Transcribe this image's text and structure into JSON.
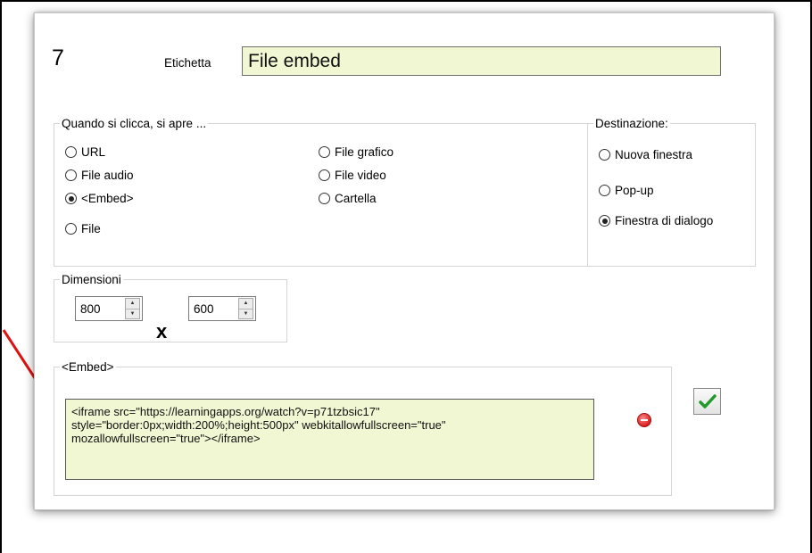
{
  "header": {
    "number": "7",
    "label_text": "Etichetta",
    "label_value": "File embed"
  },
  "open_group": {
    "legend": "Quando si clicca, si apre ...",
    "options": [
      {
        "label": "URL",
        "selected": false
      },
      {
        "label": "File audio",
        "selected": false
      },
      {
        "label": "<Embed>",
        "selected": true
      },
      {
        "label": "File",
        "selected": false
      },
      {
        "label": "File grafico",
        "selected": false
      },
      {
        "label": "File video",
        "selected": false
      },
      {
        "label": "Cartella",
        "selected": false
      }
    ]
  },
  "destination_group": {
    "legend": "Destinazione:",
    "options": [
      {
        "label": "Nuova finestra",
        "selected": false
      },
      {
        "label": "Pop-up",
        "selected": false
      },
      {
        "label": "Finestra di dialogo",
        "selected": true
      }
    ]
  },
  "dimensions_group": {
    "legend": "Dimensioni",
    "width": "800",
    "height": "600",
    "separator": "x"
  },
  "embed_group": {
    "legend": "<Embed>",
    "code": "<iframe src=\"https://learningapps.org/watch?v=p71tzbsic17\"\nstyle=\"border:0px;width:200%;height:500px\" webkitallowfullscreen=\"true\"\nmozallowfullscreen=\"true\"></iframe>"
  },
  "icons": {
    "remove": "minus-circle-icon",
    "confirm": "checkmark-icon",
    "annotation": "red-arrow-icon"
  },
  "colors": {
    "input_background": "#f0f7d2",
    "remove_red": "#d81f1f",
    "check_green": "#1f9a2b",
    "arrow_red": "#e01010"
  }
}
